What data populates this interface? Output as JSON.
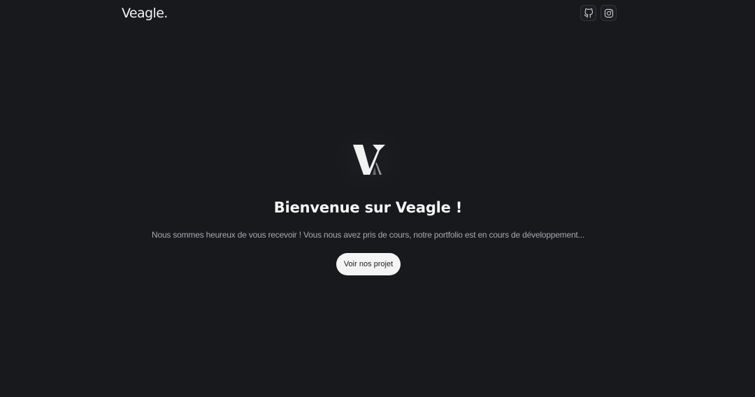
{
  "header": {
    "brand": "Veagle.",
    "socials": [
      {
        "icon": "github-icon"
      },
      {
        "icon": "instagram-icon"
      }
    ]
  },
  "hero": {
    "logo_icon": "veagle-logo",
    "title": "Bienvenue sur Veagle !",
    "text": "Nous sommes heureux de vous recevoir ! Vous nous avez pris de cours, notre portfolio est en cours de développement...",
    "cta_label": "Voir nos projet"
  },
  "colors": {
    "background": "#18191d",
    "text_primary": "#f6f6f6",
    "text_muted": "#a7a8ad",
    "button_bg": "#f4f4f4",
    "button_text": "#1b1c20"
  }
}
